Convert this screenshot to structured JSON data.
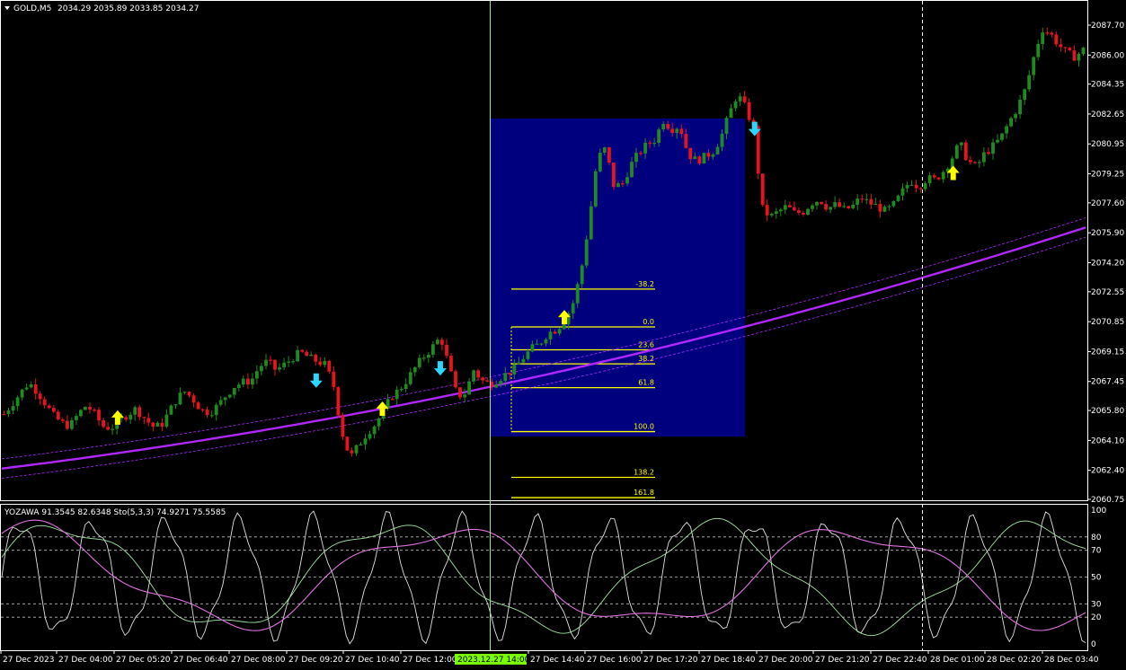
{
  "header": {
    "symbol_label": "GOLD,M5",
    "ohlc": "2034.29 2035.89 2033.85 2034.27"
  },
  "indicator_header": "YOZAWA 91.3545 82.6348  Sto(5,3,3) 74.9271 75.5585",
  "colors": {
    "background": "#000000",
    "bull_bar": "#1f8a1f",
    "bear_bar": "#e5141e",
    "fib_box": "#00007f",
    "fib_line": "#ffff00",
    "ma_line": "#b028ff",
    "up_arrow": "#ffff00",
    "down_arrow": "#28d8ff",
    "crosshair": "#90ee90",
    "grid_text": "#ffffff",
    "date_highlight": "#7cfc00"
  },
  "price_axis": {
    "min": 2060.75,
    "max": 2088.5,
    "labels": [
      "2087.70",
      "2086.00",
      "2084.35",
      "2082.65",
      "2080.95",
      "2079.25",
      "2077.60",
      "2075.90",
      "2074.20",
      "2072.55",
      "2070.85",
      "2069.15",
      "2067.45",
      "2065.80",
      "2064.10",
      "2062.40",
      "2060.75"
    ]
  },
  "oscillator_axis": {
    "labels": [
      "100",
      "80",
      "70",
      "50",
      "30",
      "20",
      "0"
    ],
    "levels": [
      100,
      80,
      70,
      50,
      30,
      20,
      0
    ]
  },
  "time_axis": {
    "labels": [
      "27 Dec 2023",
      "27 Dec 04:00",
      "27 Dec 05:20",
      "27 Dec 06:40",
      "27 Dec 08:00",
      "27 Dec 09:20",
      "27 Dec 10:40",
      "27 Dec 12:00",
      "27 Dec 14:40",
      "27 Dec 16:00",
      "27 Dec 17:20",
      "27 Dec 18:40",
      "27 Dec 20:00",
      "27 Dec 21:20",
      "27 Dec 22:40",
      "28 Dec 01:00",
      "28 Dec 02:20",
      "28 Dec 03:40"
    ],
    "highlight_label": "2023.12.27 14:00"
  },
  "fibonacci": {
    "levels": [
      {
        "label": "-38.2",
        "price": 2072.7
      },
      {
        "label": "0.0",
        "price": 2070.55
      },
      {
        "label": "23.6",
        "price": 2069.25
      },
      {
        "label": "38.2",
        "price": 2068.45
      },
      {
        "label": "61.8",
        "price": 2067.1
      },
      {
        "label": "100.0",
        "price": 2064.6
      },
      {
        "label": "138.2",
        "price": 2062.0
      },
      {
        "label": "161.8",
        "price": 2060.85
      }
    ]
  },
  "chart_data": {
    "type": "candlestick",
    "symbol": "GOLD",
    "timeframe": "M5",
    "price_path": [
      2065.6,
      2066.2,
      2066.8,
      2067.4,
      2066.9,
      2066.2,
      2065.5,
      2065.1,
      2064.9,
      2065.6,
      2066.1,
      2065.6,
      2064.9,
      2064.8,
      2065.2,
      2065.6,
      2065.9,
      2065.4,
      2064.9,
      2064.9,
      2065.7,
      2066.5,
      2066.9,
      2066.4,
      2065.8,
      2065.7,
      2066.1,
      2066.7,
      2067.2,
      2067.4,
      2067.5,
      2068.3,
      2068.6,
      2068.1,
      2068.4,
      2068.8,
      2069.1,
      2068.8,
      2068.6,
      2068.4,
      2067.2,
      2064.6,
      2063.1,
      2063.8,
      2064.5,
      2065.0,
      2065.7,
      2066.6,
      2067.0,
      2067.6,
      2068.3,
      2068.9,
      2069.4,
      2070.0,
      2068.3,
      2066.6,
      2066.8,
      2068.1,
      2067.5,
      2067.3,
      2067.6,
      2067.9,
      2068.2,
      2068.8,
      2069.3,
      2069.6,
      2070.2,
      2070.4,
      2070.9,
      2071.8,
      2073.6,
      2076.5,
      2080.1,
      2080.7,
      2078.6,
      2078.6,
      2079.7,
      2080.4,
      2080.9,
      2081.2,
      2082.3,
      2081.8,
      2082.0,
      2080.4,
      2080.0,
      2080.2,
      2080.5,
      2081.3,
      2082.6,
      2083.8,
      2083.0,
      2081.8,
      2077.3,
      2076.8,
      2077.1,
      2077.4,
      2077.0,
      2077.1,
      2077.6,
      2077.8,
      2077.3,
      2077.5,
      2077.2,
      2077.4,
      2077.9,
      2077.6,
      2077.4,
      2077.1,
      2077.5,
      2078.2,
      2078.9,
      2078.5,
      2079.0,
      2078.9,
      2079.4,
      2080.1,
      2081.0,
      2080.0,
      2079.6,
      2080.4,
      2080.8,
      2081.3,
      2082.2,
      2083.0,
      2084.1,
      2085.9,
      2087.5,
      2087.2,
      2086.6,
      2086.1,
      2085.9,
      2086.3
    ],
    "price_range": [
      2060.75,
      2088.5
    ],
    "signals_up": [
      {
        "bar": 14,
        "price": 2065.3
      },
      {
        "bar": 46,
        "price": 2065.8
      },
      {
        "bar": 68,
        "price": 2071.0
      },
      {
        "bar": 115,
        "price": 2079.2
      }
    ],
    "signals_down": [
      {
        "bar": 38,
        "price": 2067.6
      },
      {
        "bar": 53,
        "price": 2068.3
      },
      {
        "bar": 91,
        "price": 2081.9
      }
    ],
    "moving_average": {
      "start": 2062.5,
      "end": 2076.2
    },
    "stochastic": {
      "main": 74.9271,
      "signal": 75.5585
    },
    "yozawa": [
      91.3545,
      82.6348
    ]
  }
}
